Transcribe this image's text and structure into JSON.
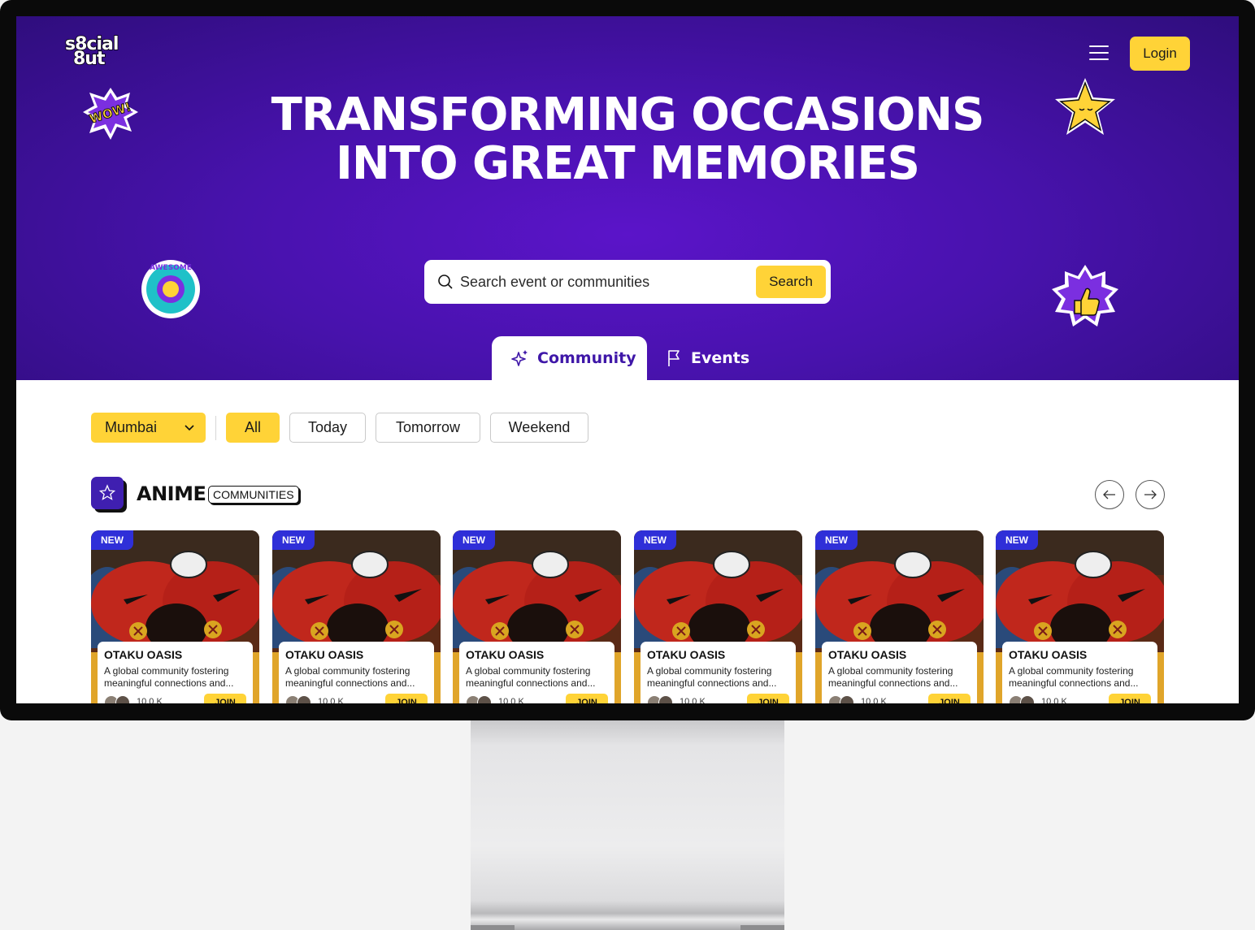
{
  "app": {
    "logo_text_line1": "s8cial",
    "logo_text_line2": "8ut"
  },
  "header": {
    "login_label": "Login"
  },
  "hero": {
    "title": "TRANSFORMING OCCASIONS INTO GREAT MEMORIES",
    "stickers": [
      "WOW!",
      "AWESOME",
      "star",
      "thumbs-up"
    ]
  },
  "search": {
    "placeholder": "Search event or communities",
    "button_label": "Search"
  },
  "tabs": [
    {
      "label": "Community",
      "active": true
    },
    {
      "label": "Events",
      "active": false
    }
  ],
  "filters": {
    "city": "Mumbai",
    "chips": [
      {
        "label": "All",
        "active": true
      },
      {
        "label": "Today",
        "active": false
      },
      {
        "label": "Tomorrow",
        "active": false
      },
      {
        "label": "Weekend",
        "active": false
      }
    ]
  },
  "section": {
    "title": "ANIME",
    "badge": "COMMUNITIES"
  },
  "cards": [
    {
      "badge": "NEW",
      "title": "OTAKU OASIS",
      "description": "A global community fostering meaningful connections and...",
      "members": "10.0 K",
      "join_label": "JOIN"
    },
    {
      "badge": "NEW",
      "title": "OTAKU OASIS",
      "description": "A global community fostering meaningful connections and...",
      "members": "10.0 K",
      "join_label": "JOIN"
    },
    {
      "badge": "NEW",
      "title": "OTAKU OASIS",
      "description": "A global community fostering meaningful connections and...",
      "members": "10.0 K",
      "join_label": "JOIN"
    },
    {
      "badge": "NEW",
      "title": "OTAKU OASIS",
      "description": "A global community fostering meaningful connections and...",
      "members": "10.0 K",
      "join_label": "JOIN"
    },
    {
      "badge": "NEW",
      "title": "OTAKU OASIS",
      "description": "A global community fostering meaningful connections and...",
      "members": "10.0 K",
      "join_label": "JOIN"
    },
    {
      "badge": "NEW",
      "title": "OTAKU OASIS",
      "description": "A global community fostering meaningful connections and...",
      "members": "10.0 K",
      "join_label": "JOIN"
    }
  ],
  "colors": {
    "hero_purple": "#4812ad",
    "accent_yellow": "#ffd337",
    "tab_active_text": "#3f17a8",
    "new_badge": "#2f2fd8"
  }
}
